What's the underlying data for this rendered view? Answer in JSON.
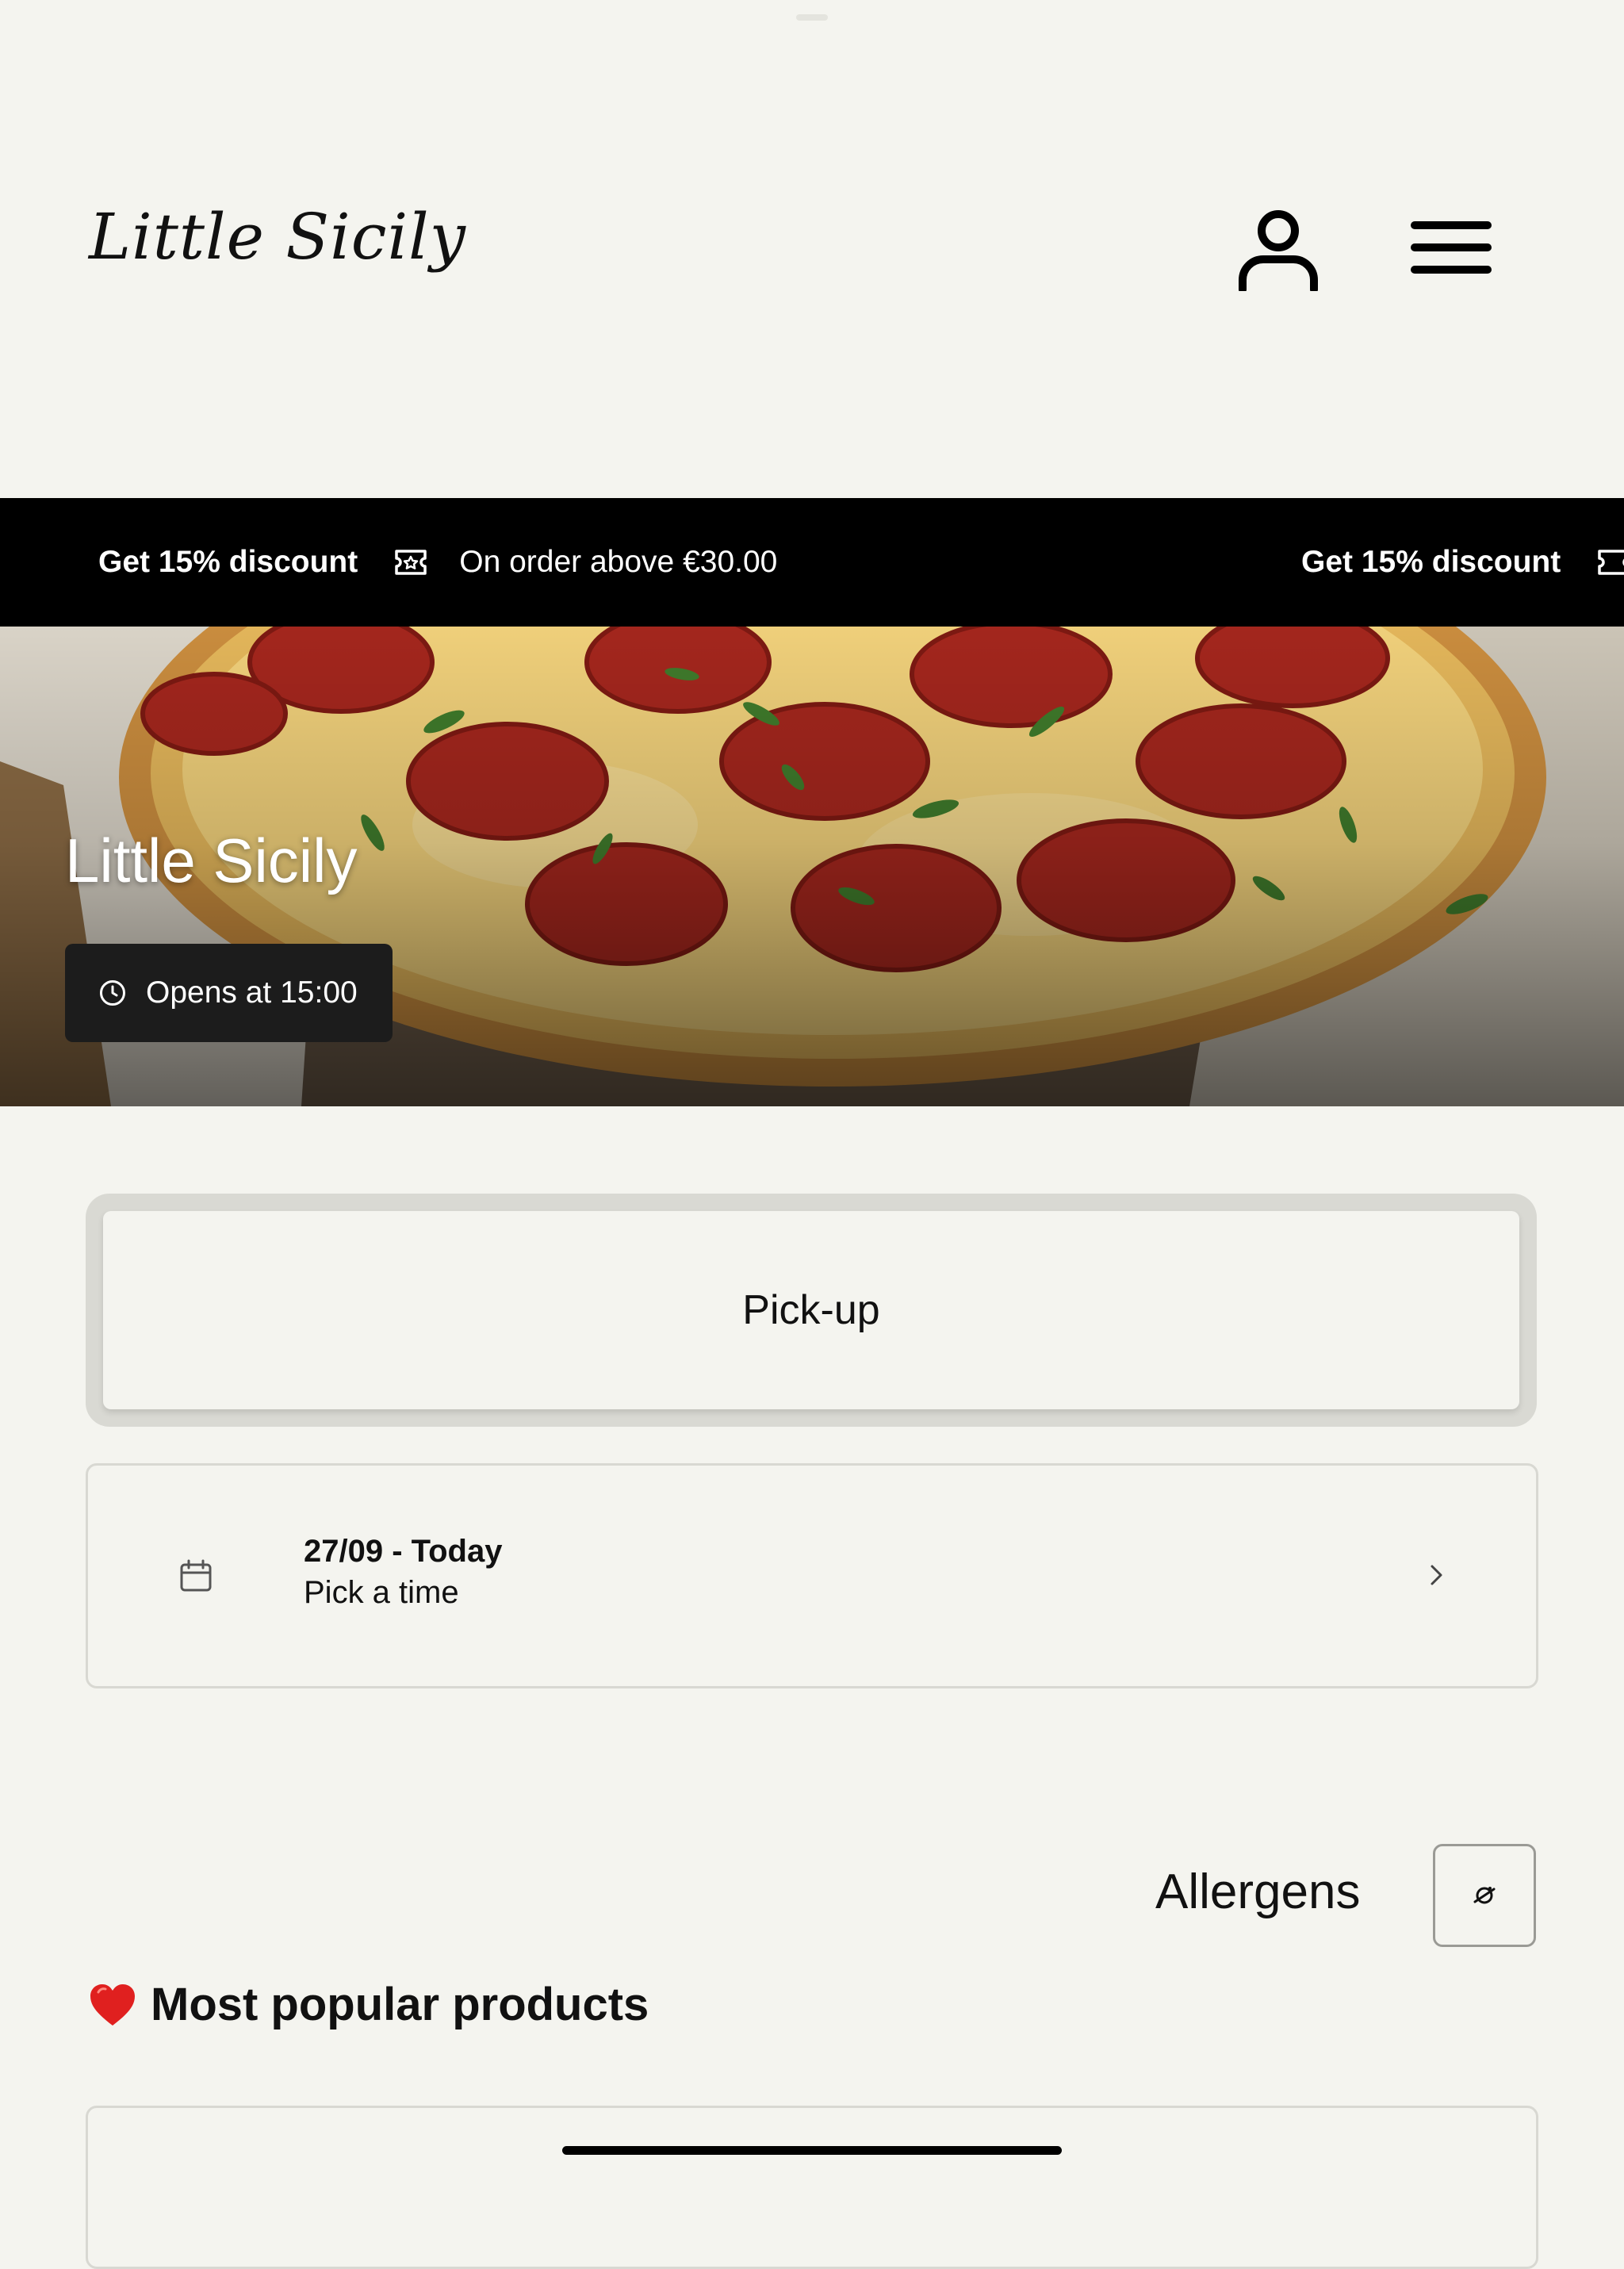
{
  "header": {
    "logo_text": "Little Sicily",
    "account_icon": "user-icon",
    "menu_icon": "hamburger-menu-icon"
  },
  "promo": {
    "items": [
      {
        "title": "Get 15% discount",
        "detail": "On order above €30.00",
        "icon": "ticket-icon"
      },
      {
        "title": "Get 15% discount",
        "detail": "",
        "icon": "ticket-icon"
      }
    ]
  },
  "hero": {
    "restaurant_name": "Little Sicily",
    "hours_text": "Opens at 15:00",
    "hours_icon": "clock-icon"
  },
  "order": {
    "mode_label": "Pick-up",
    "date_label": "27/09 - Today",
    "time_label": "Pick a time",
    "date_icon": "calendar-icon"
  },
  "allergens": {
    "label": "Allergens",
    "icon": "allergen-filter-icon"
  },
  "popular": {
    "heading": "Most popular products",
    "icon": "heart-icon"
  },
  "colors": {
    "background": "#f4f4ef",
    "promo_bar": "#000000",
    "text": "#111111",
    "border": "#d8d8d2"
  }
}
